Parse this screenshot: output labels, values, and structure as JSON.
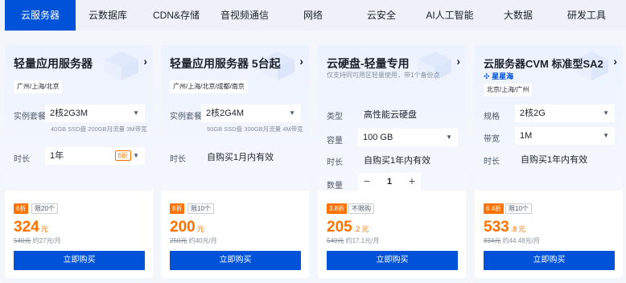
{
  "tabs": [
    "云服务器",
    "云数据库",
    "CDN&存储",
    "音视频通信",
    "网络",
    "云安全",
    "AI人工智能",
    "大数据",
    "研发工具"
  ],
  "colors": {
    "accent": "#0052d9",
    "price": "#ff7200",
    "tab_bar": "#eef2f8"
  },
  "cards": [
    {
      "title": "轻量应用服务器",
      "region": "广州/上海/北京",
      "spec_label": "实例套餐",
      "spec_value": "2核2G3M",
      "spec_note": "40GB SSD盘 200GB月流量 3M带宽",
      "duration_label": "时长",
      "duration_value": "1年",
      "duration_badge": "6折",
      "discount": "6折",
      "limit": "限20个",
      "price": "324",
      "price_unit": "元",
      "orig_price": "540元",
      "orig_monthly": "约27元/月",
      "buy": "立即购买"
    },
    {
      "title": "轻量应用服务器 5台起",
      "region": "广州/上海/北京/成都/南京",
      "spec_label": "实例套餐",
      "spec_value": "2核2G4M",
      "spec_note": "50GB SSD盘 300GB月流量 4M带宽",
      "duration_label": "时长",
      "duration_value": "自购买1月内有效",
      "discount": "8折",
      "limit": "限10个",
      "price": "200",
      "price_unit": "元",
      "orig_price": "250元",
      "orig_monthly": "约40元/月",
      "buy": "立即购买"
    },
    {
      "title": "云硬盘-轻量专用",
      "subtitle": "仅支持同可用区轻量使用，带1个备份点",
      "type_label": "类型",
      "type_value": "高性能云硬盘",
      "capacity_label": "容量",
      "capacity_value": "100 GB",
      "duration_label": "时长",
      "duration_value": "自购买1年内有效",
      "qty_label": "数量",
      "qty_minus": "−",
      "qty_value": "1",
      "qty_plus": "+",
      "discount": "3.8折",
      "limit": "不限购",
      "price": "205",
      "price_decimal": ".2",
      "price_unit": "元",
      "orig_price": "540元",
      "orig_monthly": "约17.1元/月",
      "buy": "立即购买"
    },
    {
      "title": "云服务器CVM 标准型SA2",
      "brand": "星星海",
      "region": "北京/上海/广州",
      "spec_label": "规格",
      "spec_value": "2核2G",
      "bw_label": "带宽",
      "bw_value": "1M",
      "duration_label": "时长",
      "duration_value": "自购买1年内有效",
      "discount": "6.4折",
      "limit": "限10个",
      "price": "533",
      "price_decimal": ".8",
      "price_unit": "元",
      "orig_price": "834元",
      "orig_monthly": "约44.48元/月",
      "buy": "立即购买"
    }
  ]
}
